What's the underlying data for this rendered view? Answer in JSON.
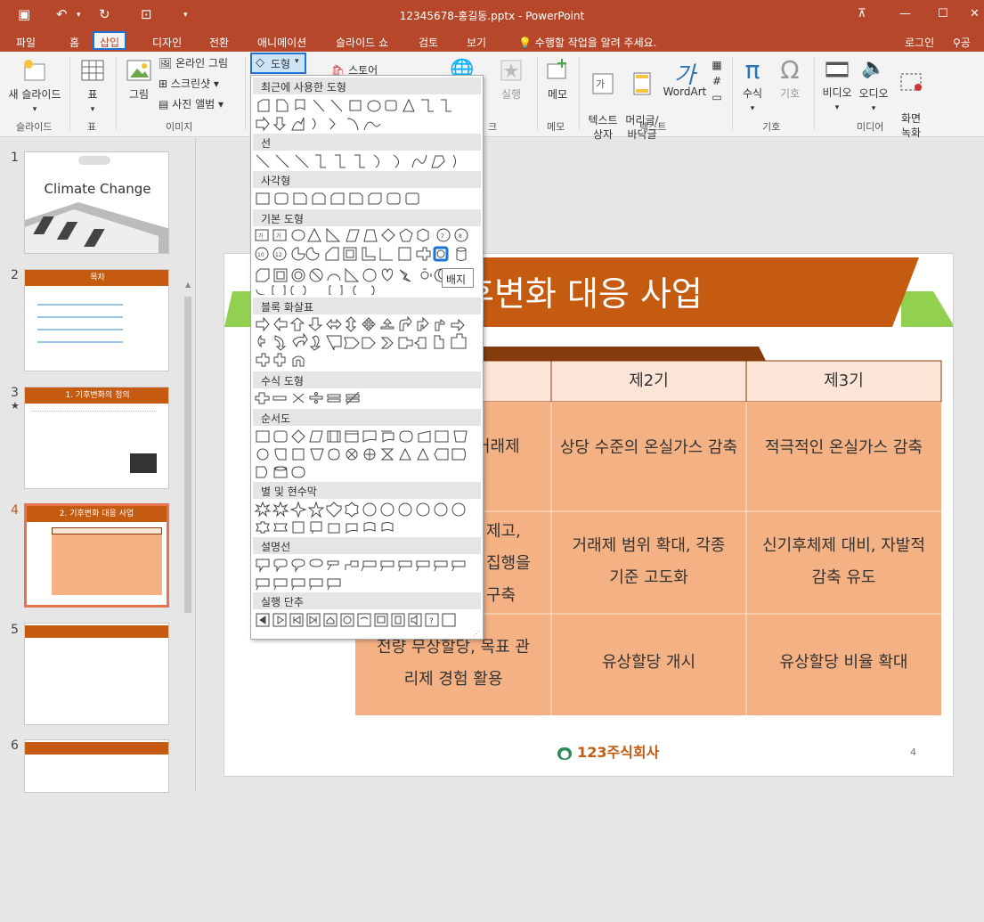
{
  "titlebar": {
    "title": "12345678-홍길동.pptx - PowerPoint"
  },
  "tabs": [
    {
      "label": "파일",
      "active": false
    },
    {
      "label": "홈",
      "active": false
    },
    {
      "label": "삽입",
      "active": true
    },
    {
      "label": "디자인",
      "active": false
    },
    {
      "label": "전환",
      "active": false
    },
    {
      "label": "애니메이션",
      "active": false
    },
    {
      "label": "슬라이드 쇼",
      "active": false
    },
    {
      "label": "검토",
      "active": false
    },
    {
      "label": "보기",
      "active": false
    }
  ],
  "tell_me": "수행할 작업을 알려 주세요.",
  "login": "로그인",
  "share": "공유",
  "ribbon": {
    "new_slide": "새 슬라이드",
    "table": "표",
    "picture": "그림",
    "online_picture": "온라인 그림",
    "screenshot": "스크린샷",
    "photo_album": "사진 앨범",
    "shapes": "도형",
    "store": "스토어",
    "action": "실행",
    "comment": "메모",
    "textbox": "텍스트\n상자",
    "header_footer": "머리글/\n바닥글",
    "wordart": "WordArt",
    "equation": "수식",
    "symbol": "기호",
    "video": "비디오",
    "audio": "오디오",
    "screen_record": "화면\n녹화",
    "groups": {
      "slides": "슬라이드",
      "tables": "표",
      "images": "이미지",
      "comments": "메모",
      "text": "텍스트",
      "symbols": "기호",
      "media": "미디어",
      "links": "크"
    }
  },
  "dropdown": {
    "sections": [
      "최근에 사용한 도형",
      "선",
      "사각형",
      "기본 도형",
      "블록 화살표",
      "수식 도형",
      "순서도",
      "별 및 현수막",
      "설명선",
      "실행 단추"
    ],
    "tooltip": "배지"
  },
  "thumbs": {
    "numbers": [
      "1",
      "2",
      "3",
      "4",
      "5",
      "6"
    ],
    "slide1_title": "Climate Change",
    "slide2_title": "목차",
    "slide3_title": "1. 기후변화의 정의",
    "slide4_title": "2. 기후변화 대응 사업"
  },
  "slide": {
    "title": "기후변화 대응 사업",
    "title_visible": "후변화 대응 사업",
    "headers": [
      "제2기",
      "제3기"
    ],
    "rows": [
      [
        "거래제",
        "상당 수준의 온실가스 감축",
        "적극적인 온실가스 감축"
      ],
      [
        "제고, 집행을 구축",
        "거래제 범위 확대, 각종 기준 고도화",
        "신기후체제 대비, 자발적 감축 유도"
      ],
      [
        "전량 무상할당, 목표 관리제 경험 활용",
        "유상할당 개시",
        "유상할당 비율 확대"
      ]
    ],
    "logo": "123주식회사",
    "page_number": "4"
  },
  "colors": {
    "accent": "#b7472a",
    "slide_orange": "#c55a11",
    "green": "#92d050",
    "table_body": "#f4b183",
    "table_header": "#fbe5d6",
    "table_header_border": "#843c0c",
    "highlight_blue": "#1e74d4"
  }
}
